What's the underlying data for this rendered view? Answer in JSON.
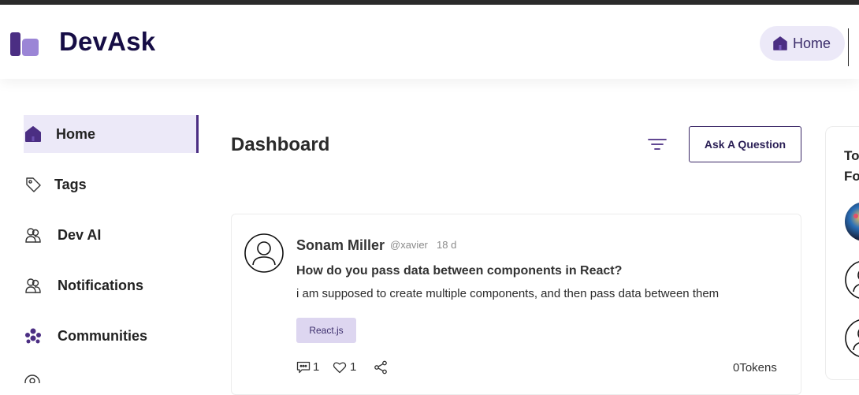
{
  "app": {
    "brand": "DevAsk"
  },
  "header": {
    "home_label": "Home"
  },
  "sidebar": {
    "items": [
      {
        "label": "Home",
        "icon": "home-icon",
        "active": true
      },
      {
        "label": "Tags",
        "icon": "tag-icon"
      },
      {
        "label": "Dev AI",
        "icon": "users-icon"
      },
      {
        "label": "Notifications",
        "icon": "users-icon"
      },
      {
        "label": "Communities",
        "icon": "community-icon"
      }
    ]
  },
  "main": {
    "title": "Dashboard",
    "ask_button": "Ask A Question",
    "questions": [
      {
        "author": "Sonam Miller",
        "handle": "@xavier",
        "age": "18 d",
        "title": "How do you pass data between components in React?",
        "body": "i am supposed to create multiple components, and then pass data between them",
        "tags": [
          "React.js"
        ],
        "comments": "1",
        "likes": "1",
        "tokens": "0Tokens"
      }
    ]
  },
  "right_panel": {
    "title_line1": "Top",
    "title_line2": "Fol"
  },
  "colors": {
    "accent": "#4b2e83",
    "brand": "#160d45",
    "tag_bg": "#ddd6f0",
    "active_bg": "#ece9f8"
  }
}
